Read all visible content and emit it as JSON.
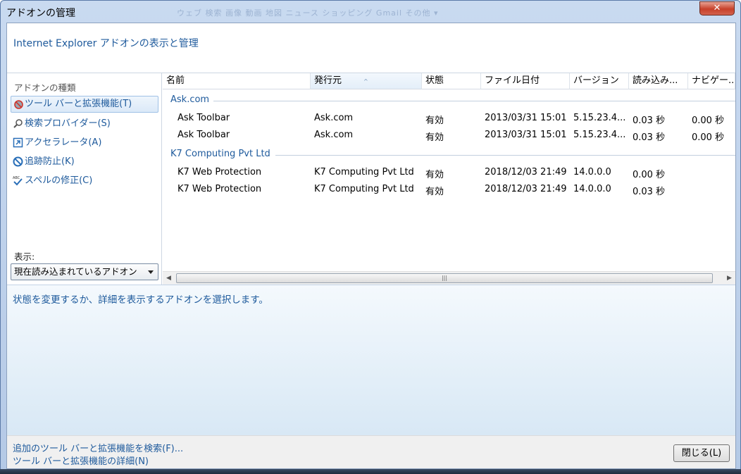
{
  "window": {
    "title": "アドオンの管理",
    "close_glyph": "✕",
    "ghost_title": "ウェブ  検索  画像  動画  地図  ニュース  ショッピング  Gmail  その他 ▾"
  },
  "header": {
    "title": "Internet Explorer アドオンの表示と管理"
  },
  "sidebar": {
    "types_label": "アドオンの種類",
    "items": [
      {
        "label": "ツール バーと拡張機能(T)",
        "icon": "toolbar-gear-icon",
        "selected": true
      },
      {
        "label": "検索プロバイダー(S)",
        "icon": "search-icon",
        "selected": false
      },
      {
        "label": "アクセラレータ(A)",
        "icon": "accelerator-icon",
        "selected": false
      },
      {
        "label": "追跡防止(K)",
        "icon": "block-icon",
        "selected": false
      },
      {
        "label": "スペルの修正(C)",
        "icon": "spell-check-icon",
        "selected": false
      }
    ],
    "show_label": "表示:",
    "show_value": "現在読み込まれているアドオン"
  },
  "list": {
    "columns": [
      "名前",
      "発行元",
      "状態",
      "ファイル日付",
      "バージョン",
      "読み込み...",
      "ナビゲー..."
    ],
    "sorted_column": 1,
    "groups": [
      {
        "name": "Ask.com",
        "rows": [
          [
            "Ask Toolbar",
            "Ask.com",
            "有効",
            "2013/03/31 15:01",
            "5.15.23.4...",
            "0.03 秒",
            "0.00 秒"
          ],
          [
            "Ask Toolbar",
            "Ask.com",
            "有効",
            "2013/03/31 15:01",
            "5.15.23.4...",
            "0.03 秒",
            "0.00 秒"
          ]
        ]
      },
      {
        "name": "K7 Computing Pvt Ltd",
        "rows": [
          [
            "K7 Web Protection",
            "K7 Computing Pvt Ltd",
            "有効",
            "2018/12/03 21:49",
            "14.0.0.0",
            "0.00 秒",
            ""
          ],
          [
            "K7 Web Protection",
            "K7 Computing Pvt Ltd",
            "有効",
            "2018/12/03 21:49",
            "14.0.0.0",
            "0.03 秒",
            ""
          ]
        ]
      }
    ]
  },
  "details": {
    "message": "状態を変更するか、詳細を表示するアドオンを選択します。"
  },
  "footer": {
    "link_find": "追加のツール バーと拡張機能を検索(F)...",
    "link_learn": "ツール バーと拡張機能の詳細(N)",
    "close_label": "閉じる(L)"
  }
}
